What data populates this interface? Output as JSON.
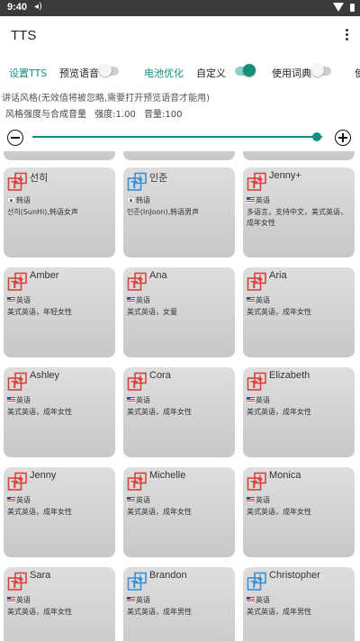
{
  "status": {
    "time": "9:40"
  },
  "appbar": {
    "title": "TTS"
  },
  "tabs": {
    "setup": "设置TTS",
    "preview": "预览语音",
    "preview_on": false,
    "battery": "电池优化",
    "custom": "自定义",
    "custom_on": true,
    "dict": "使用词典",
    "dict_on": false,
    "cut": "使"
  },
  "style_hint": "讲话风格(无效值将被忽略,需要打开预览语音才能用)",
  "strength": {
    "label": "风格强度与合成音量",
    "strength_text": "强度:1.00",
    "volume_text": "音量:100",
    "level": 0.98
  },
  "colors": {
    "accent": "#138f7e",
    "icon_red": "#d9413a",
    "icon_blue": "#3a8fd6"
  },
  "voices": [
    {
      "name": "선히",
      "flag": "kr",
      "lang": "韩语",
      "desc": "선히(SunHi),韩语女声",
      "icon": "red"
    },
    {
      "name": "인준",
      "flag": "kr",
      "lang": "韩语",
      "desc": "인준(InJoon),韩语男声",
      "icon": "blue"
    },
    {
      "name": "Jenny+",
      "flag": "us",
      "lang": "英语",
      "desc": "多语言，支持中文，美式英语，成年女性",
      "icon": "red"
    },
    {
      "name": "Amber",
      "flag": "us",
      "lang": "英语",
      "desc": "美式英语，年轻女性",
      "icon": "red"
    },
    {
      "name": "Ana",
      "flag": "us",
      "lang": "英语",
      "desc": "美式英语，女童",
      "icon": "red"
    },
    {
      "name": "Aria",
      "flag": "us",
      "lang": "英语",
      "desc": "美式英语，成年女性",
      "icon": "red"
    },
    {
      "name": "Ashley",
      "flag": "us",
      "lang": "英语",
      "desc": "美式英语，成年女性",
      "icon": "red"
    },
    {
      "name": "Cora",
      "flag": "us",
      "lang": "英语",
      "desc": "美式英语，成年女性",
      "icon": "red"
    },
    {
      "name": "Elizabeth",
      "flag": "us",
      "lang": "英语",
      "desc": "美式英语，成年女性",
      "icon": "red"
    },
    {
      "name": "Jenny",
      "flag": "us",
      "lang": "英语",
      "desc": "美式英语，成年女性",
      "icon": "red"
    },
    {
      "name": "Michelle",
      "flag": "us",
      "lang": "英语",
      "desc": "美式英语，成年女性",
      "icon": "red"
    },
    {
      "name": "Monica",
      "flag": "us",
      "lang": "英语",
      "desc": "美式英语，成年女性",
      "icon": "red"
    },
    {
      "name": "Sara",
      "flag": "us",
      "lang": "英语",
      "desc": "美式英语，成年女性",
      "icon": "red"
    },
    {
      "name": "Brandon",
      "flag": "us",
      "lang": "英语",
      "desc": "美式英语，成年男性",
      "icon": "blue"
    },
    {
      "name": "Christopher",
      "flag": "us",
      "lang": "英语",
      "desc": "美式英语，成年男性",
      "icon": "blue"
    }
  ]
}
